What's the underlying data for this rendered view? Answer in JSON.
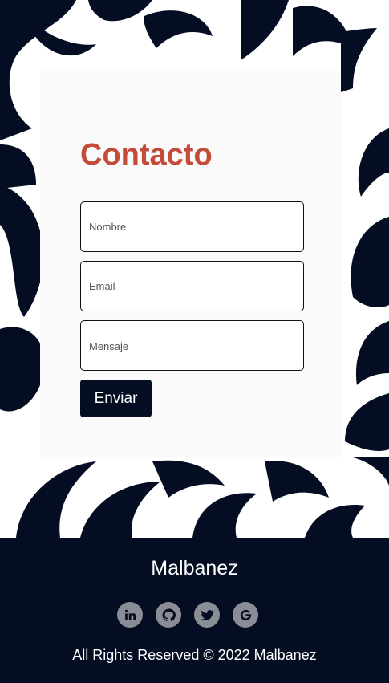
{
  "contact": {
    "title": "Contacto",
    "name_placeholder": "Nombre",
    "email_placeholder": "Email",
    "message_placeholder": "Mensaje",
    "submit_label": "Enviar"
  },
  "footer": {
    "brand": "Malbanez",
    "socials": [
      {
        "icon": "linkedin-icon"
      },
      {
        "icon": "github-icon"
      },
      {
        "icon": "twitter-icon"
      },
      {
        "icon": "google-icon"
      }
    ],
    "copyright": "All Rights Reserved © 2022 Malbanez"
  },
  "colors": {
    "accent": "#c44a39",
    "navy": "#050d22",
    "card_bg": "#fafafa",
    "social_bg": "#8a8d96"
  }
}
